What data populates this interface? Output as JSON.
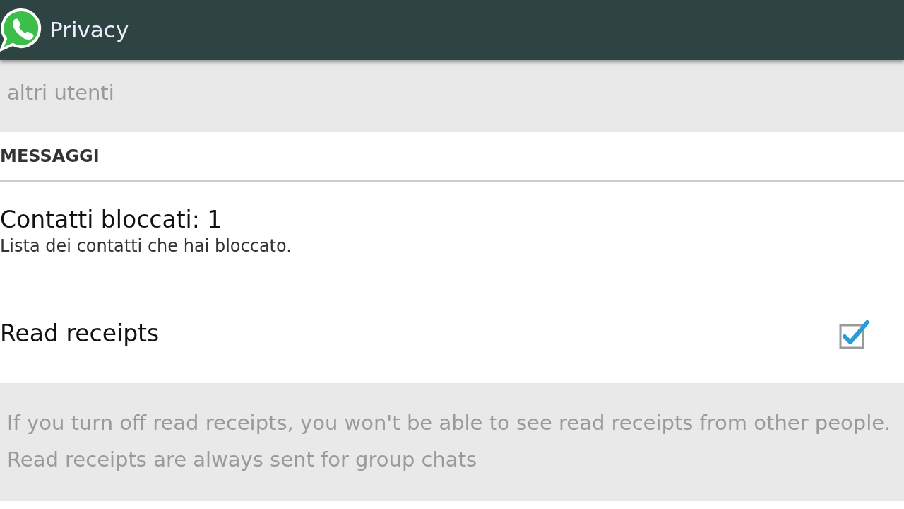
{
  "header": {
    "title": "Privacy"
  },
  "items": [
    {
      "kind": "note",
      "text": "altri utenti"
    },
    {
      "kind": "section",
      "text": "MESSAGGI"
    },
    {
      "kind": "entry",
      "title": "Contatti bloccati: 1",
      "subtitle": "Lista dei contatti che hai bloccato."
    },
    {
      "kind": "toggle",
      "title": "Read receipts",
      "checked": true
    },
    {
      "kind": "note",
      "text": "If you turn off read receipts, you won't be able to see read receipts from other people. Read receipts are always sent for group chats"
    }
  ]
}
